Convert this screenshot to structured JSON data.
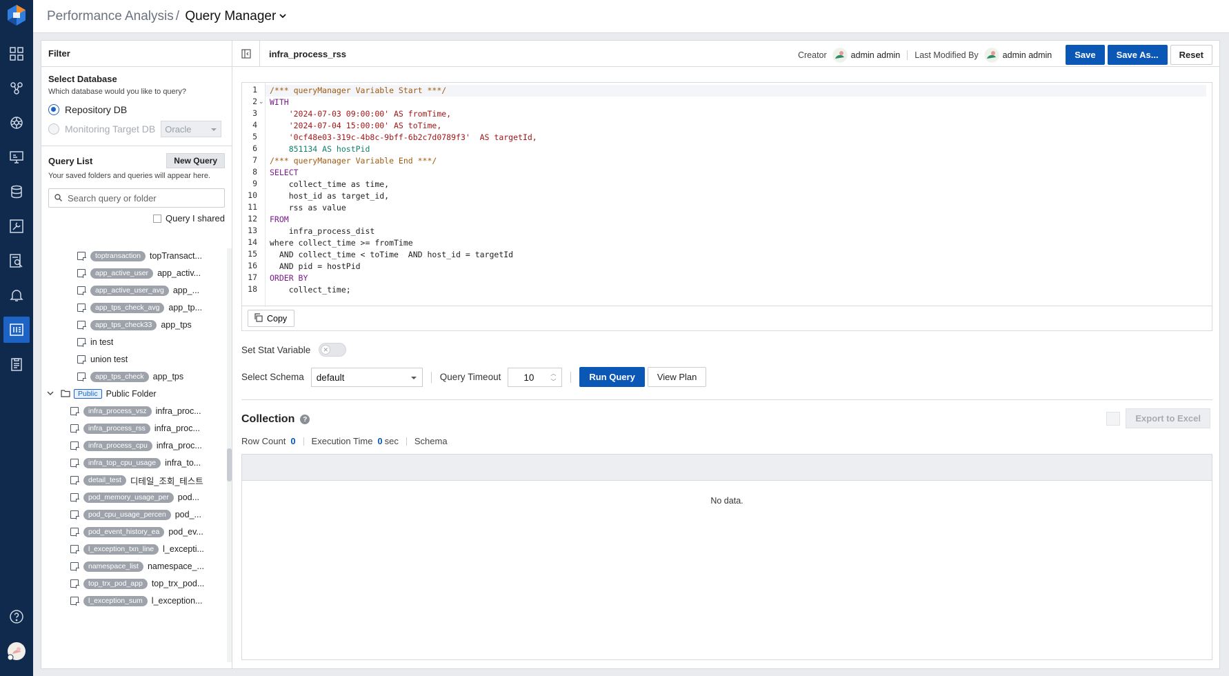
{
  "header": {
    "breadcrumb_parent": "Performance Analysis",
    "breadcrumb_sep": "/",
    "breadcrumb_current": "Query Manager"
  },
  "filter": {
    "title": "Filter",
    "select_db_title": "Select Database",
    "select_db_sub": "Which database would you like to query?",
    "radio_repository": "Repository DB",
    "radio_monitoring": "Monitoring Target DB",
    "db_type": "Oracle",
    "query_list_title": "Query List",
    "new_query": "New Query",
    "query_list_sub": "Your saved folders and queries will appear here.",
    "search_placeholder": "Search query or folder",
    "shared_label": "Query I shared"
  },
  "tree": [
    {
      "tag": "toptransaction",
      "name": "topTransact..."
    },
    {
      "tag": "app_active_user",
      "name": "app_activ..."
    },
    {
      "tag": "app_active_user_avg",
      "name": "app_..."
    },
    {
      "tag": "app_tps_check_avg",
      "name": "app_tp..."
    },
    {
      "tag": "app_tps_check33",
      "name": "app_tps"
    },
    {
      "tag": "",
      "name": "in test"
    },
    {
      "tag": "",
      "name": "union test"
    },
    {
      "tag": "app_tps_check",
      "name": "app_tps"
    }
  ],
  "public_folder": {
    "tag": "Public",
    "name": "Public Folder"
  },
  "public_items": [
    {
      "tag": "infra_process_vsz",
      "name": "infra_proc..."
    },
    {
      "tag": "infra_process_rss",
      "name": "infra_proc..."
    },
    {
      "tag": "infra_process_cpu",
      "name": "infra_proc..."
    },
    {
      "tag": "infra_top_cpu_usage",
      "name": "infra_to..."
    },
    {
      "tag": "detail_test",
      "name": "디테일_조회_테스트"
    },
    {
      "tag": "pod_memory_usage_per",
      "name": "pod..."
    },
    {
      "tag": "pod_cpu_usage_percen",
      "name": "pod_..."
    },
    {
      "tag": "pod_event_history_ea",
      "name": "pod_ev..."
    },
    {
      "tag": "l_exception_txn_line",
      "name": "l_excepti..."
    },
    {
      "tag": "namespace_list",
      "name": "namespace_..."
    },
    {
      "tag": "top_trx_pod_app",
      "name": "top_trx_pod..."
    },
    {
      "tag": "l_exception_sum",
      "name": "l_exception..."
    },
    {
      "tag": "",
      "name": ""
    }
  ],
  "main": {
    "query_name": "infra_process_rss",
    "creator_label": "Creator",
    "creator_name": "admin admin",
    "modified_label": "Last Modified By",
    "modified_name": "admin admin",
    "save": "Save",
    "save_as": "Save As...",
    "reset": "Reset",
    "copy": "Copy",
    "stat_label": "Set Stat Variable",
    "schema_label": "Select Schema",
    "schema_value": "default",
    "timeout_label": "Query Timeout",
    "timeout_value": "10",
    "run_query": "Run Query",
    "view_plan": "View Plan",
    "collection_title": "Collection",
    "export": "Export to Excel",
    "row_count_label": "Row Count",
    "row_count": "0",
    "exec_label": "Execution Time",
    "exec_value": "0",
    "exec_unit": "sec",
    "schema_info": "Schema",
    "no_data": "No data."
  },
  "code_lines": [
    "/*** queryManager Variable Start ***/",
    "WITH",
    "    '2024-07-03 09:00:00' AS fromTime,",
    "    '2024-07-04 15:00:00' AS toTime,",
    "    '0cf48e03-319c-4b8c-9bff-6b2c7d0789f3'  AS targetId,",
    "    851134 AS hostPid",
    "/*** queryManager Variable End ***/",
    "SELECT",
    "    collect_time as time,",
    "    host_id as target_id,",
    "    rss as value",
    "FROM",
    "    infra_process_dist",
    "where collect_time >= fromTime",
    "  AND collect_time < toTime  AND host_id = targetId",
    "  AND pid = hostPid",
    "ORDER BY",
    "    collect_time;"
  ],
  "colors": {
    "rail": "#0f2a4d",
    "accent": "#0b57b5",
    "keyword": "#7a1a8c",
    "comment": "#a15a10",
    "string": "#a31515"
  }
}
